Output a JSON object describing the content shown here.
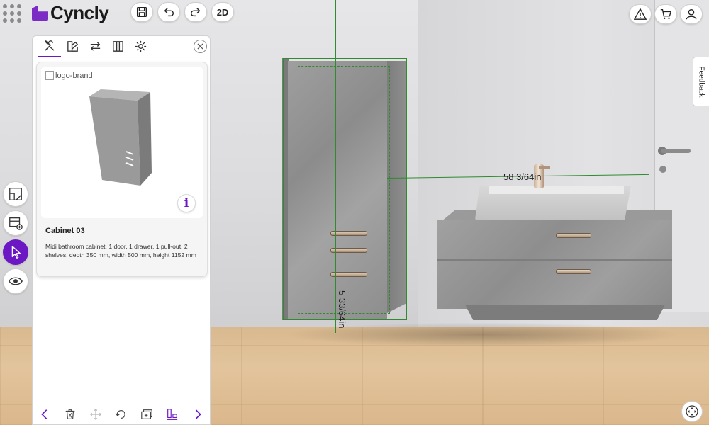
{
  "app": {
    "name": "Cyncly",
    "brand_color": "#6b18c4"
  },
  "toolbar": {
    "save_icon": "save-icon",
    "undo_icon": "undo-icon",
    "redo_icon": "redo-icon",
    "view_toggle_label": "2D",
    "warning_icon": "warning-icon",
    "cart_icon": "cart-icon",
    "user_icon": "user-icon"
  },
  "left_rail": {
    "items": [
      {
        "icon": "floorplan-icon",
        "active": false
      },
      {
        "icon": "add-furniture-icon",
        "active": false
      },
      {
        "icon": "select-cursor-icon",
        "active": true
      },
      {
        "icon": "eye-icon",
        "active": false
      }
    ]
  },
  "panel": {
    "tabs": [
      {
        "icon": "tools-icon",
        "active": true
      },
      {
        "icon": "materials-icon",
        "active": false
      },
      {
        "icon": "swap-icon",
        "active": false
      },
      {
        "icon": "catalog-icon",
        "active": false
      },
      {
        "icon": "gear-icon",
        "active": false
      }
    ],
    "product": {
      "image_alt": "logo-brand",
      "title": "Cabinet 03",
      "description": "Midi bathroom cabinet, 1 door, 1 drawer, 1 pull-out, 2 shelves, depth 350 mm, width 500 mm, height 1152 mm",
      "info_label": "i"
    },
    "footer": [
      {
        "icon": "chevron-left-icon"
      },
      {
        "icon": "trash-icon"
      },
      {
        "icon": "move-icon"
      },
      {
        "icon": "rotate-icon"
      },
      {
        "icon": "duplicate-icon"
      },
      {
        "icon": "align-icon"
      },
      {
        "icon": "chevron-right-icon"
      }
    ]
  },
  "scene": {
    "dimension_horizontal": "58 3/64in",
    "dimension_vertical": "5 33/64in"
  },
  "feedback_label": "Feedback"
}
